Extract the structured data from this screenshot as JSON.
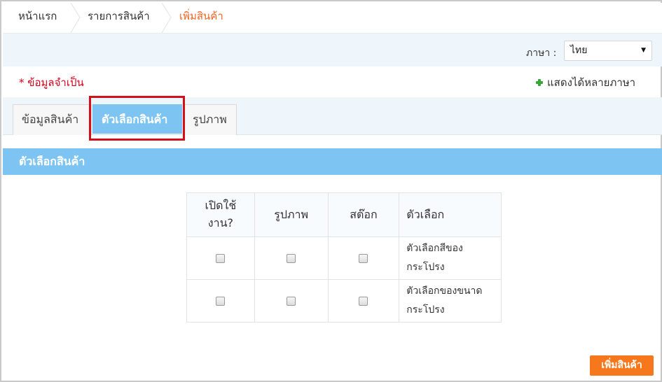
{
  "breadcrumb": {
    "items": [
      "หน้าแรก",
      "รายการสินค้า",
      "เพิ่มสินค้า"
    ]
  },
  "language": {
    "label": "ภาษา :",
    "selected": "ไทย"
  },
  "notes": {
    "required": "* ข้อมูลจำเป็น",
    "multi_language": "แสดงได้หลายภาษา"
  },
  "tabs": [
    {
      "label": "ข้อมูลสินค้า",
      "active": false
    },
    {
      "label": "ตัวเลือกสินค้า",
      "active": true
    },
    {
      "label": "รูปภาพ",
      "active": false
    }
  ],
  "section": {
    "title": "ตัวเลือกสินค้า"
  },
  "options_table": {
    "headers": {
      "enabled_line1": "เปิดใช้",
      "enabled_line2": "งาน?",
      "image": "รูปภาพ",
      "stock": "สต๊อก",
      "option": "ตัวเลือก"
    },
    "rows": [
      {
        "line1": "ตัวเลือกสีของ",
        "line2": "กระโปรง",
        "enabled": false,
        "image": false,
        "stock": false
      },
      {
        "line1": "ตัวเลือกของขนาด",
        "line2": "กระโปรง",
        "enabled": false,
        "image": false,
        "stock": false
      }
    ]
  },
  "actions": {
    "add_product": "เพิ่มสินค้า"
  },
  "colors": {
    "accent_blue": "#7ec4f2",
    "highlight_red": "#d3101a",
    "button_orange": "#f7781c",
    "required_red": "#d9001b"
  }
}
